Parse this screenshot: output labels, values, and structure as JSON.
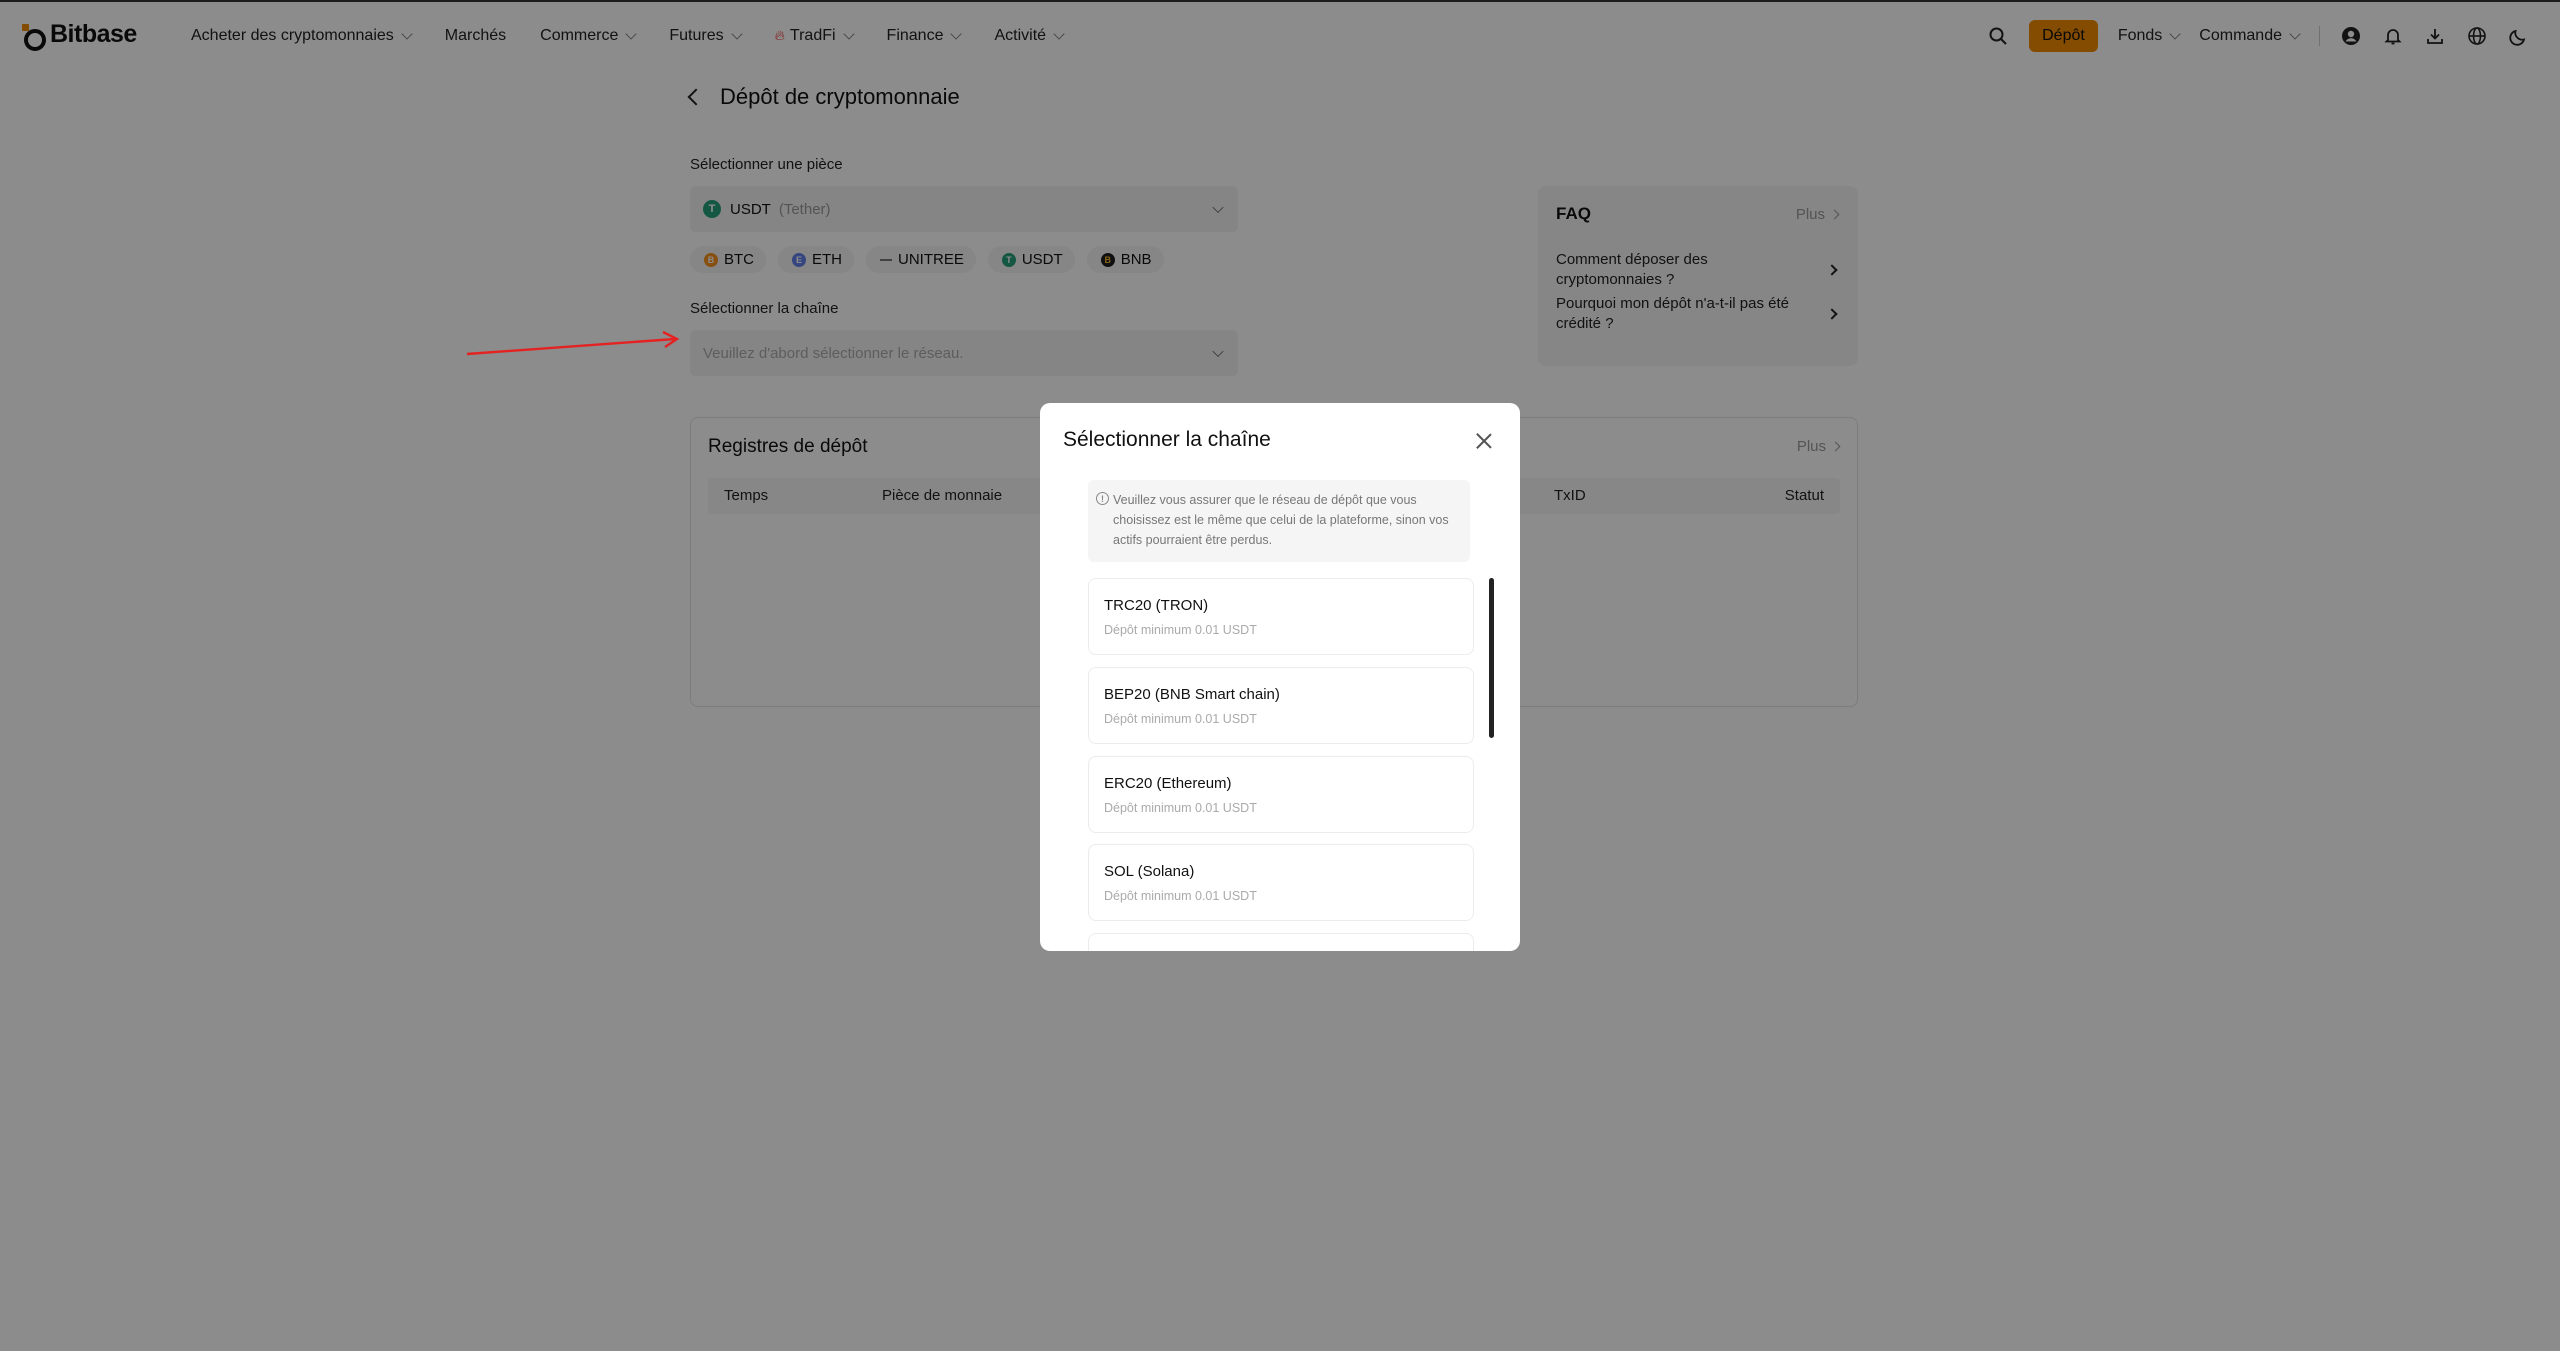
{
  "header": {
    "logo": "Bitbase",
    "nav": [
      {
        "label": "Acheter des cryptomonnaies",
        "dropdown": true
      },
      {
        "label": "Marchés",
        "dropdown": false
      },
      {
        "label": "Commerce",
        "dropdown": true
      },
      {
        "label": "Futures",
        "dropdown": true
      },
      {
        "label": "TradFi",
        "dropdown": true
      },
      {
        "label": "Finance",
        "dropdown": true
      },
      {
        "label": "Activité",
        "dropdown": true
      }
    ],
    "deposit_label": "Dépôt",
    "funds_label": "Fonds",
    "order_label": "Commande",
    "accent": "#f08a00"
  },
  "page": {
    "title": "Dépôt de cryptomonnaie",
    "coin_label": "Sélectionner une pièce",
    "selected_coin": "USDT",
    "selected_coin_full": "(Tether)",
    "quick_coins": [
      "BTC",
      "ETH",
      "UNITREE",
      "USDT",
      "BNB"
    ],
    "chain_label": "Sélectionner la chaîne",
    "chain_placeholder": "Veuillez d'abord sélectionner le réseau."
  },
  "faq": {
    "title": "FAQ",
    "more": "Plus",
    "items": [
      "Comment déposer des cryptomonnaies ?",
      "Pourquoi mon dépôt n'a-t-il pas été crédité ?"
    ]
  },
  "records": {
    "title": "Registres de dépôt",
    "more": "Plus",
    "columns": [
      "Temps",
      "Pièce de monnaie",
      "TxID",
      "Statut"
    ]
  },
  "modal": {
    "title": "Sélectionner la chaîne",
    "notice": "Veuillez vous assurer que le réseau de dépôt que vous choisissez est le même que celui de la plateforme, sinon vos actifs pourraient être perdus.",
    "chains": [
      {
        "name": "TRC20 (TRON)",
        "min": "Dépôt minimum 0.01 USDT"
      },
      {
        "name": "BEP20 (BNB Smart chain)",
        "min": "Dépôt minimum 0.01 USDT"
      },
      {
        "name": "ERC20 (Ethereum)",
        "min": "Dépôt minimum 0.01 USDT"
      },
      {
        "name": "SOL (Solana)",
        "min": "Dépôt minimum 0.01 USDT"
      }
    ]
  }
}
